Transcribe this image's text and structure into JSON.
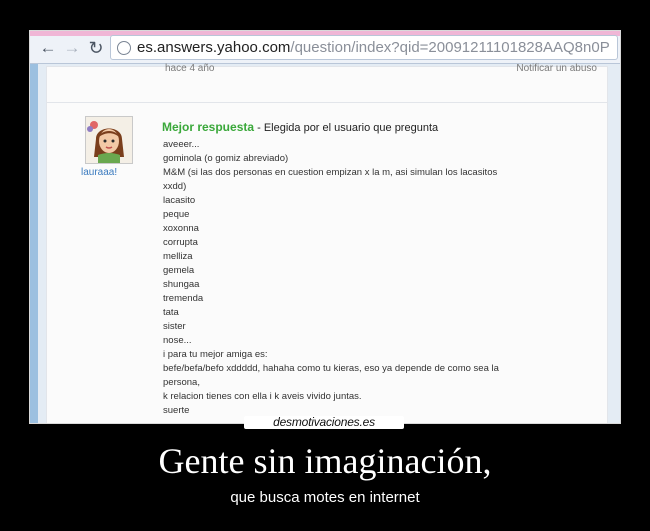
{
  "browser": {
    "url_host": "es.answers.yahoo.com",
    "url_path": "/question/index?qid=20091211101828AAQ8n0P",
    "icons": [
      "back-arrow",
      "forward-arrow",
      "reload",
      "globe"
    ]
  },
  "page": {
    "cut_text_left": "hace 4 año",
    "cut_text_right": "Notificar un abuso",
    "answer": {
      "best_label": "Mejor respuesta",
      "chosen_by": " - Elegida por el usuario que pregunta",
      "username": "lauraaa!",
      "lines": [
        "aveeer...",
        "gominola (o gomiz abreviado)",
        "M&M (si las dos personas en cuestion empizan x la m, asi simulan los lacasitos",
        "xxdd)",
        "lacasito",
        "peque",
        "xoxonna",
        "corrupta",
        "melliza",
        "gemela",
        "shungaa",
        "tremenda",
        "tata",
        "sister",
        "nose...",
        "i para tu mejor amiga es:",
        "befe/befa/befo xddddd, hahaha como tu kieras, eso ya depende de como sea la",
        "persona,",
        "k relacion tienes con ella i k aveis vivido juntas.",
        "suerte"
      ]
    }
  },
  "poster": {
    "site": "desmotivaciones.es",
    "title": "Gente sin imaginación,",
    "subtitle": "que busca motes en internet"
  },
  "colors": {
    "best_answer": "#3aa83a",
    "username": "#3b7bbf",
    "background": "#000000",
    "page_side": "#9cc0e0"
  }
}
